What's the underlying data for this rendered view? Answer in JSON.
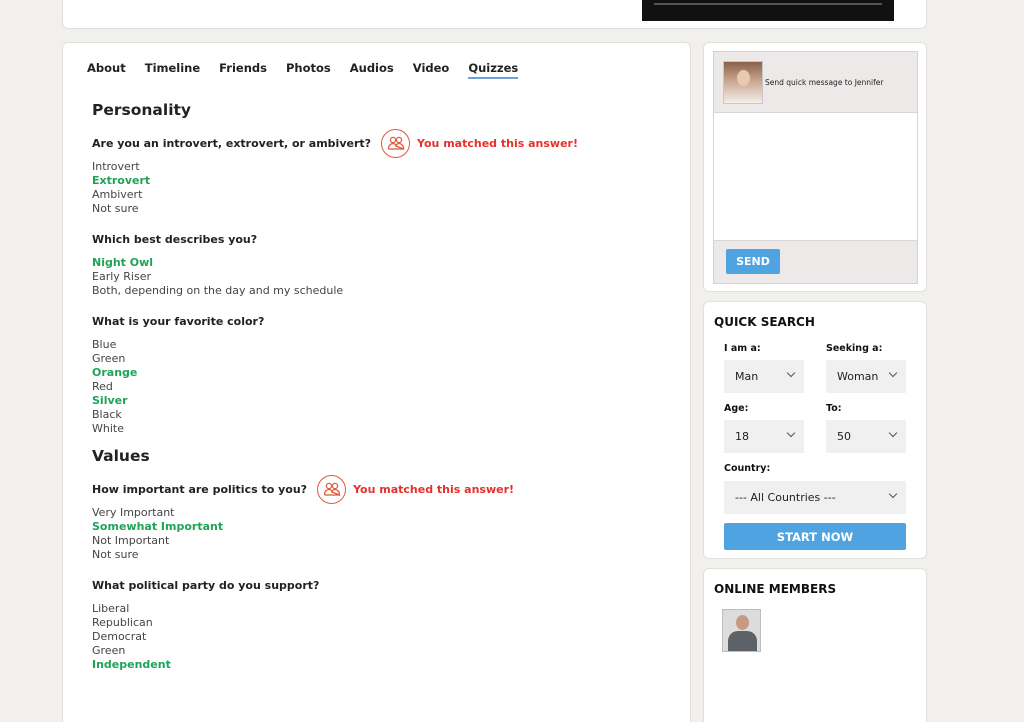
{
  "tabs": [
    {
      "label": "About",
      "active": false
    },
    {
      "label": "Timeline",
      "active": false
    },
    {
      "label": "Friends",
      "active": false
    },
    {
      "label": "Photos",
      "active": false
    },
    {
      "label": "Audios",
      "active": false
    },
    {
      "label": "Video",
      "active": false
    },
    {
      "label": "Quizzes",
      "active": true
    }
  ],
  "match_text": "You matched this answer!",
  "sections": [
    {
      "title": "Personality",
      "questions": [
        {
          "question": "Are you an introvert, extrovert, or ambivert?",
          "matched": true,
          "answers": [
            {
              "text": "Introvert",
              "selected": false
            },
            {
              "text": "Extrovert",
              "selected": true
            },
            {
              "text": "Ambivert",
              "selected": false
            },
            {
              "text": "Not sure",
              "selected": false
            }
          ]
        },
        {
          "question": "Which best describes you?",
          "matched": false,
          "answers": [
            {
              "text": "Night Owl",
              "selected": true
            },
            {
              "text": "Early Riser",
              "selected": false
            },
            {
              "text": "Both, depending on the day and my schedule",
              "selected": false
            }
          ]
        },
        {
          "question": "What is your favorite color?",
          "matched": false,
          "answers": [
            {
              "text": "Blue",
              "selected": false
            },
            {
              "text": "Green",
              "selected": false
            },
            {
              "text": "Orange",
              "selected": true
            },
            {
              "text": "Red",
              "selected": false
            },
            {
              "text": "Silver",
              "selected": true
            },
            {
              "text": "Black",
              "selected": false
            },
            {
              "text": "White",
              "selected": false
            }
          ]
        }
      ]
    },
    {
      "title": "Values",
      "questions": [
        {
          "question": "How important are politics to you?",
          "matched": true,
          "answers": [
            {
              "text": "Very Important",
              "selected": false
            },
            {
              "text": "Somewhat Important",
              "selected": true
            },
            {
              "text": "Not Important",
              "selected": false
            },
            {
              "text": "Not sure",
              "selected": false
            }
          ]
        },
        {
          "question": "What political party do you support?",
          "matched": false,
          "answers": [
            {
              "text": "Liberal",
              "selected": false
            },
            {
              "text": "Republican",
              "selected": false
            },
            {
              "text": "Democrat",
              "selected": false
            },
            {
              "text": "Green",
              "selected": false
            },
            {
              "text": "Independent",
              "selected": true
            }
          ]
        }
      ]
    }
  ],
  "message_panel": {
    "label": "Send quick message to  Jennifer",
    "send_label": "SEND"
  },
  "quick_search": {
    "title": "QUICK SEARCH",
    "i_am_label": "I am a:",
    "i_am_value": "Man",
    "seeking_label": "Seeking a:",
    "seeking_value": "Woman",
    "age_label": "Age:",
    "age_from": "18",
    "to_label": "To:",
    "age_to": "50",
    "country_label": "Country:",
    "country_value": "--- All Countries ---",
    "start_label": "START NOW"
  },
  "online_members": {
    "title": "ONLINE MEMBERS"
  },
  "colors": {
    "selected_answer": "#1ea358",
    "match": "#e8302b",
    "button": "#4fa3e0"
  }
}
